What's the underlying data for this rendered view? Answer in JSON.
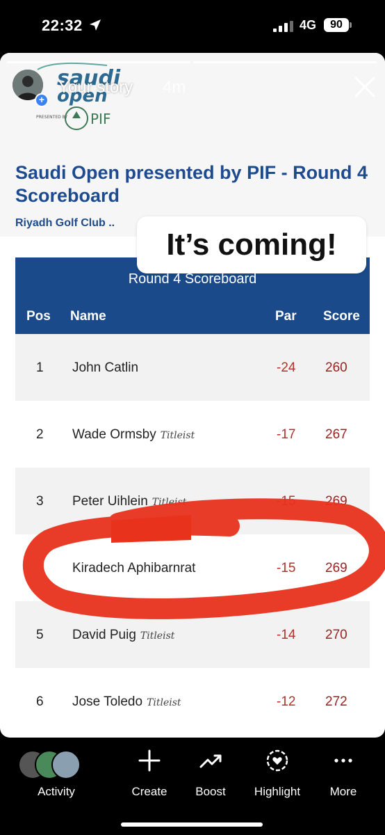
{
  "status_bar": {
    "time": "22:32",
    "network": "4G",
    "battery": "90"
  },
  "story": {
    "user_label": "Your story",
    "time_ago": "4m",
    "logo": {
      "brand": "saudi open",
      "presented_by": "PRESENTED BY",
      "sponsor": "PIF"
    },
    "title": "Saudi Open presented by PIF - Round 4 Scoreboard",
    "subtitle": "Riyadh Golf Club ..",
    "sticker_text": "It’s coming!",
    "annotation_color": "#e8321c"
  },
  "scoreboard": {
    "caption": "Round 4 Scoreboard",
    "headers": {
      "pos": "Pos",
      "name": "Name",
      "par": "Par",
      "score": "Score"
    },
    "rows": [
      {
        "pos": "1",
        "name": "John Catlin",
        "sponsor": "",
        "par": "-24",
        "score": "260"
      },
      {
        "pos": "2",
        "name": "Wade Ormsby",
        "sponsor": "Titleist",
        "par": "-17",
        "score": "267"
      },
      {
        "pos": "3",
        "name": "Peter Uihlein",
        "sponsor": "Titleist",
        "par": "-15",
        "score": "269"
      },
      {
        "pos": "",
        "name": "Kiradech Aphibarnrat",
        "sponsor": "",
        "par": "-15",
        "score": "269"
      },
      {
        "pos": "5",
        "name": "David Puig",
        "sponsor": "Titleist",
        "par": "-14",
        "score": "270"
      },
      {
        "pos": "6",
        "name": "Jose Toledo",
        "sponsor": "Titleist",
        "par": "-12",
        "score": "272"
      }
    ]
  },
  "actions": [
    {
      "label": "Activity",
      "icon": "activity-avatars"
    },
    {
      "label": "Create",
      "icon": "plus-icon"
    },
    {
      "label": "Boost",
      "icon": "trend-up-icon"
    },
    {
      "label": "Highlight",
      "icon": "highlight-heart-icon"
    },
    {
      "label": "More",
      "icon": "more-icon"
    }
  ],
  "colors": {
    "header_blue": "#1a4a8a",
    "title_blue": "#1e4b8f",
    "par_red": "#b3312c"
  }
}
